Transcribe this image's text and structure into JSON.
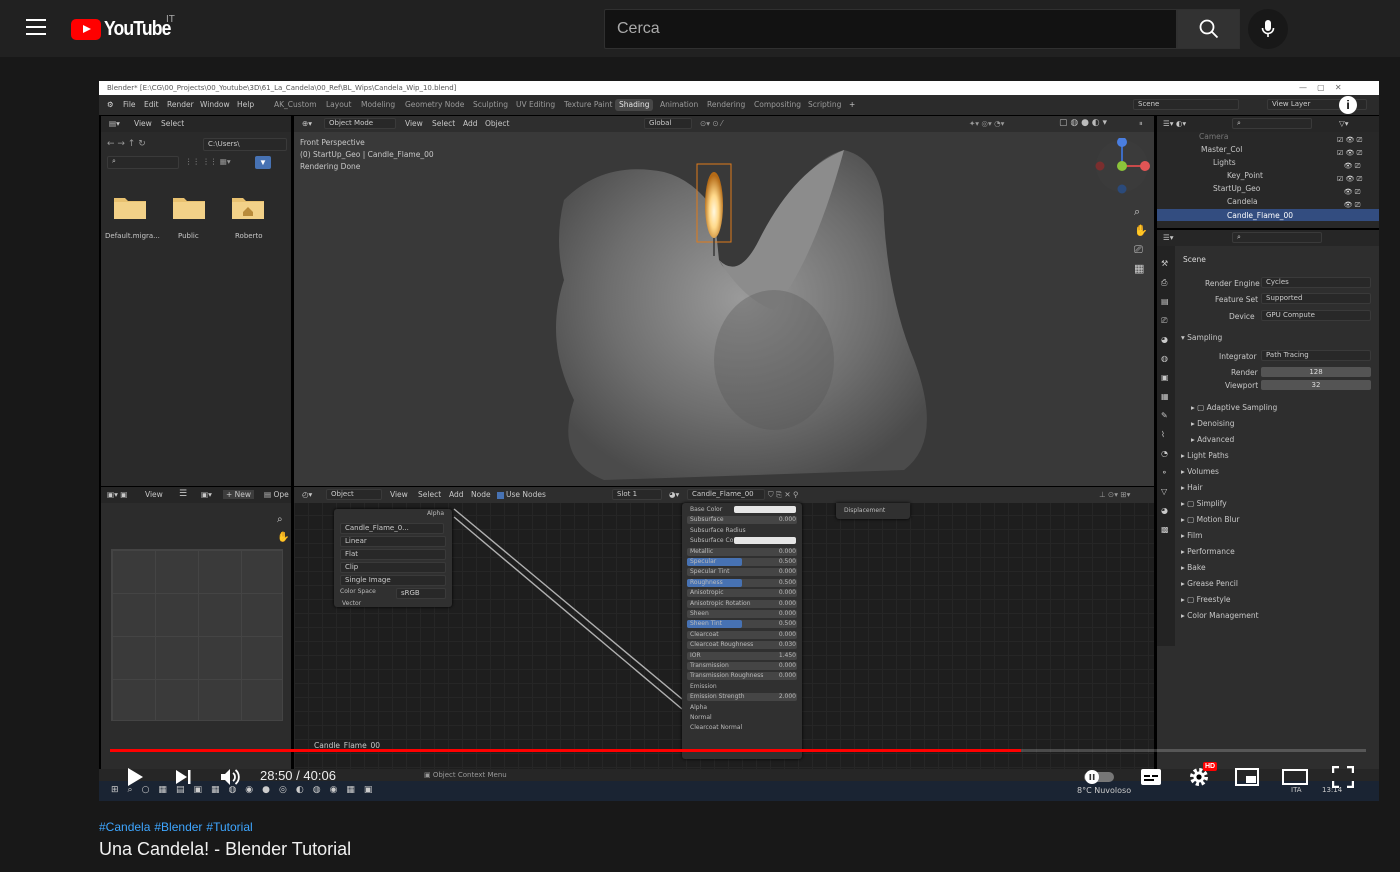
{
  "masthead": {
    "logo_text": "YouTube",
    "country_code": "IT",
    "search_placeholder": "Cerca"
  },
  "player": {
    "time_current": "28:50",
    "time_separator": " / ",
    "time_total": "40:06",
    "progress_played": 0.725,
    "progress_loaded": 0.725,
    "hd_badge": "HD"
  },
  "video": {
    "hashtags": [
      "#Candela",
      "#Blender",
      "#Tutorial"
    ],
    "title": "Una Candela! - Blender Tutorial"
  },
  "blender": {
    "window_title": "Blender* [E:\\CG\\00_Projects\\00_Youtube\\3D\\61_La_Candela\\00_Ref\\BL_Wips\\Candela_Wip_10.blend]",
    "menu": [
      "File",
      "Edit",
      "Render",
      "Window",
      "Help"
    ],
    "workspaces": [
      "AK_Custom",
      "Layout",
      "Modeling",
      "Geometry Node",
      "Sculpting",
      "UV Editing",
      "Texture Paint",
      "Shading",
      "Animation",
      "Rendering",
      "Compositing",
      "Scripting"
    ],
    "active_workspace": "Shading",
    "scene_name": "Scene",
    "view_layer": "View Layer",
    "file_browser": {
      "menu": [
        "View",
        "Select"
      ],
      "path": "C:\\Users\\",
      "folders": [
        "Default.migra...",
        "Public",
        "Roberto"
      ]
    },
    "viewport": {
      "mode": "Object Mode",
      "menu": [
        "View",
        "Select",
        "Add",
        "Object"
      ],
      "orientation": "Global",
      "info_lines": [
        "Front Perspective",
        "(0) StartUp_Geo | Candle_Flame_00",
        "Rendering Done"
      ]
    },
    "outliner": {
      "items": [
        "Camera",
        "Master_Col",
        "Lights",
        "Key_Point",
        "StartUp_Geo",
        "Candela",
        "Candle_Flame_00"
      ]
    },
    "properties": {
      "context": "Scene",
      "render_engine_label": "Render Engine",
      "render_engine": "Cycles",
      "feature_set_label": "Feature Set",
      "feature_set": "Supported",
      "device_label": "Device",
      "device": "GPU Compute",
      "sampling_label": "Sampling",
      "integrator_label": "Integrator",
      "integrator": "Path Tracing",
      "render_label": "Render",
      "render_samples": "128",
      "viewport_label": "Viewport",
      "viewport_samples": "32",
      "subpanels": [
        "Adaptive Sampling",
        "Denoising",
        "Advanced"
      ],
      "sections": [
        "Light Paths",
        "Volumes",
        "Hair",
        "Simplify",
        "Motion Blur",
        "Film",
        "Performance",
        "Bake",
        "Grease Pencil",
        "Freestyle",
        "Color Management"
      ]
    },
    "image_editor": {
      "menu_view": "View",
      "new_label": "New",
      "open_label": "Ope"
    },
    "node_editor": {
      "object_label": "Object",
      "menu": [
        "View",
        "Select",
        "Add",
        "Node"
      ],
      "use_nodes": "Use Nodes",
      "slot": "Slot 1",
      "material": "Candle_Flame_00",
      "footer_material": "Candle_Flame_00",
      "image_node": {
        "alpha": "Alpha",
        "image_name": "Candle_Flame_0...",
        "options": [
          "Linear",
          "Flat",
          "Clip",
          "Single Image"
        ],
        "color_space_label": "Color Space",
        "color_space": "sRGB",
        "vector": "Vector"
      },
      "bsdf_rows": [
        {
          "label": "Base Color",
          "value": ""
        },
        {
          "label": "Subsurface",
          "value": "0.000"
        },
        {
          "label": "Subsurface Radius",
          "value": ""
        },
        {
          "label": "Subsurface Co",
          "value": ""
        },
        {
          "label": "Metallic",
          "value": "0.000"
        },
        {
          "label": "Specular",
          "value": "0.500"
        },
        {
          "label": "Specular Tint",
          "value": "0.000"
        },
        {
          "label": "Roughness",
          "value": "0.500"
        },
        {
          "label": "Anisotropic",
          "value": "0.000"
        },
        {
          "label": "Anisotropic Rotation",
          "value": "0.000"
        },
        {
          "label": "Sheen",
          "value": "0.000"
        },
        {
          "label": "Sheen Tint",
          "value": "0.500"
        },
        {
          "label": "Clearcoat",
          "value": "0.000"
        },
        {
          "label": "Clearcoat Roughness",
          "value": "0.030"
        },
        {
          "label": "IOR",
          "value": "1.450"
        },
        {
          "label": "Transmission",
          "value": "0.000"
        },
        {
          "label": "Transmission Roughness",
          "value": "0.000"
        },
        {
          "label": "Emission",
          "value": ""
        },
        {
          "label": "Emission Strength",
          "value": "2.000"
        },
        {
          "label": "Alpha",
          "value": ""
        },
        {
          "label": "Normal",
          "value": ""
        },
        {
          "label": "Clearcoat Normal",
          "value": ""
        }
      ],
      "output_socket": "Displacement"
    },
    "status_bar": {
      "context_menu": "Object Context Menu"
    },
    "taskbar": {
      "weather": "8°C  Nuvoloso",
      "language": "ITA",
      "clock": "13:14"
    }
  },
  "colors": {
    "youtube_red": "#ff0000",
    "blender_active_blue": "#4772b3",
    "hashtag_blue": "#3ea6ff"
  }
}
